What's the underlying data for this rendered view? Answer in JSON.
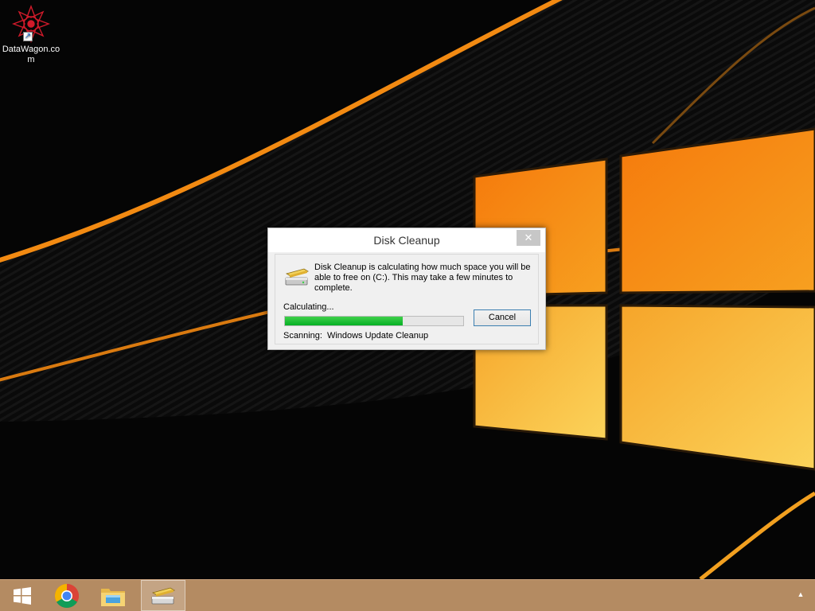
{
  "desktop": {
    "shortcut": {
      "label": "DataWagon.com",
      "icon": "datawagon-logo-icon"
    }
  },
  "dialog": {
    "title": "Disk Cleanup",
    "close_icon": "close-icon",
    "icon": "drive-cleanup-icon",
    "message": "Disk Cleanup is calculating how much space you will be able to free on  (C:). This may take a few minutes to complete.",
    "status": "Calculating...",
    "progress_fraction": 0.66,
    "scanning_label": "Scanning:",
    "scanning_target": "Windows Update Cleanup",
    "cancel_label": "Cancel",
    "progress_color": "#06b025"
  },
  "taskbar": {
    "items": [
      {
        "icon": "windows-start-icon"
      },
      {
        "icon": "chrome-icon"
      },
      {
        "icon": "file-explorer-icon"
      },
      {
        "icon": "disk-cleanup-icon",
        "active": true
      }
    ],
    "tray_icon": "chevron-up-icon",
    "color": "#b48b62"
  }
}
